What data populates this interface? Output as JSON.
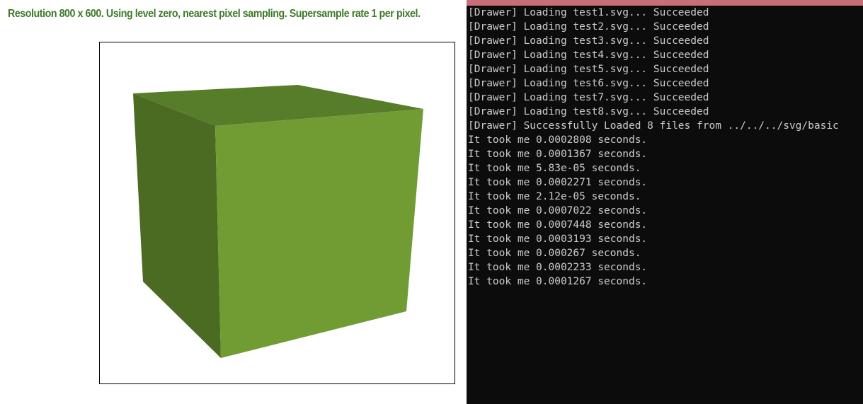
{
  "colors": {
    "status_text": "#3d7a28",
    "console_titlebar": "#c86e78",
    "console_text": "#cccccc",
    "cube_front": "#709c33",
    "cube_left": "#4b6a22",
    "cube_top": "#587d2a"
  },
  "drawer": {
    "status": "Resolution 800 x 600. Using level zero, nearest pixel sampling. Supersample rate 1 per pixel."
  },
  "console": {
    "lines": [
      "[Drawer] Loading test1.svg... Succeeded",
      "[Drawer] Loading test2.svg... Succeeded",
      "[Drawer] Loading test3.svg... Succeeded",
      "[Drawer] Loading test4.svg... Succeeded",
      "[Drawer] Loading test5.svg... Succeeded",
      "[Drawer] Loading test6.svg... Succeeded",
      "[Drawer] Loading test7.svg... Succeeded",
      "[Drawer] Loading test8.svg... Succeeded",
      "[Drawer] Successfully Loaded 8 files from ../../../svg/basic",
      "It took me 0.0002808 seconds.",
      "It took me 0.0001367 seconds.",
      "It took me 5.83e-05 seconds.",
      "It took me 0.0002271 seconds.",
      "It took me 2.12e-05 seconds.",
      "It took me 0.0007022 seconds.",
      "It took me 0.0007448 seconds.",
      "It took me 0.0003193 seconds.",
      "It took me 0.000267 seconds.",
      "It took me 0.0002233 seconds.",
      "It took me 0.0001267 seconds."
    ]
  }
}
